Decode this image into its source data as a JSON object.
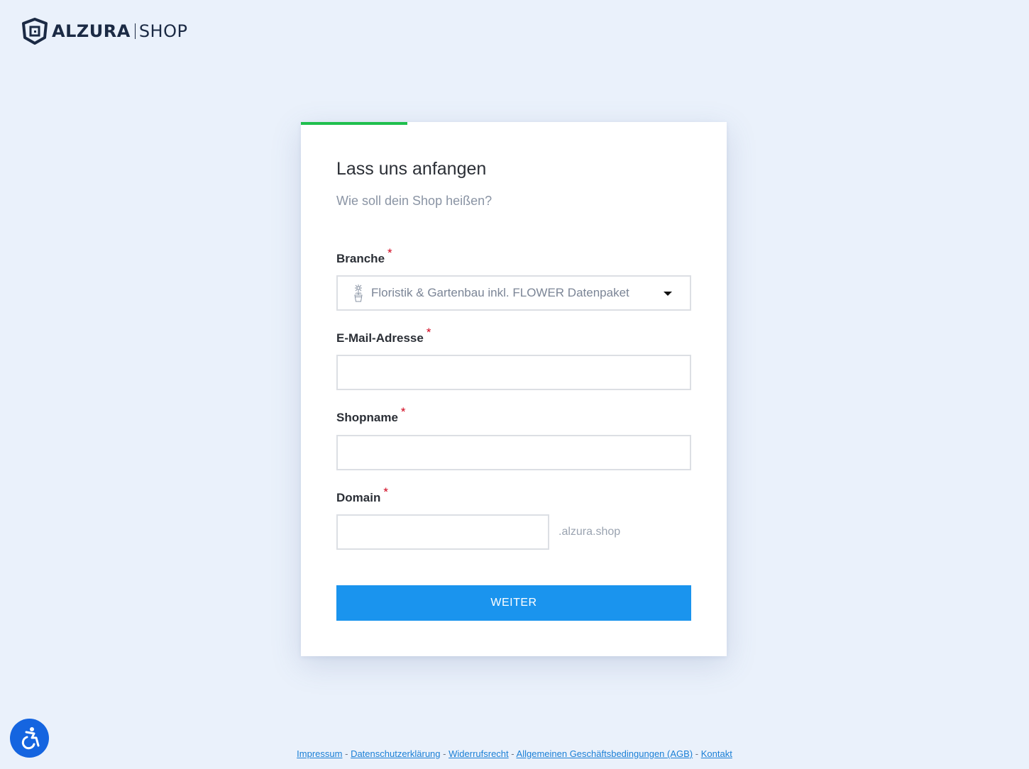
{
  "header": {
    "brand": "ALZURA",
    "product": "SHOP",
    "logo_icon": "alzura-shield-icon"
  },
  "progress": {
    "fraction": 0.25,
    "color": "#1fbf4d"
  },
  "form": {
    "title": "Lass uns anfangen",
    "subtitle": "Wie soll dein Shop heißen?",
    "required_marker": "*",
    "branche": {
      "label": "Branche",
      "selected": "Floristik & Gartenbau inkl. FLOWER Datenpaket",
      "icon": "flower-pot-icon"
    },
    "email": {
      "label": "E-Mail-Adresse",
      "value": ""
    },
    "shopname": {
      "label": "Shopname",
      "value": ""
    },
    "domain": {
      "label": "Domain",
      "value": "",
      "suffix": ".alzura.shop"
    },
    "submit_label": "WEITER"
  },
  "accessibility": {
    "icon": "wheelchair-icon",
    "color": "#1565e0"
  },
  "footer": {
    "links": [
      "Impressum",
      "Datenschutzerklärung",
      "Widerrufsrecht",
      "Allgemeinen Geschäftsbedingungen (AGB)",
      "Kontakt"
    ],
    "separator": "-"
  },
  "colors": {
    "accent": "#1a94ee",
    "background": "#eaf1fb",
    "required": "#d0021b",
    "link": "#1a7fd6"
  }
}
